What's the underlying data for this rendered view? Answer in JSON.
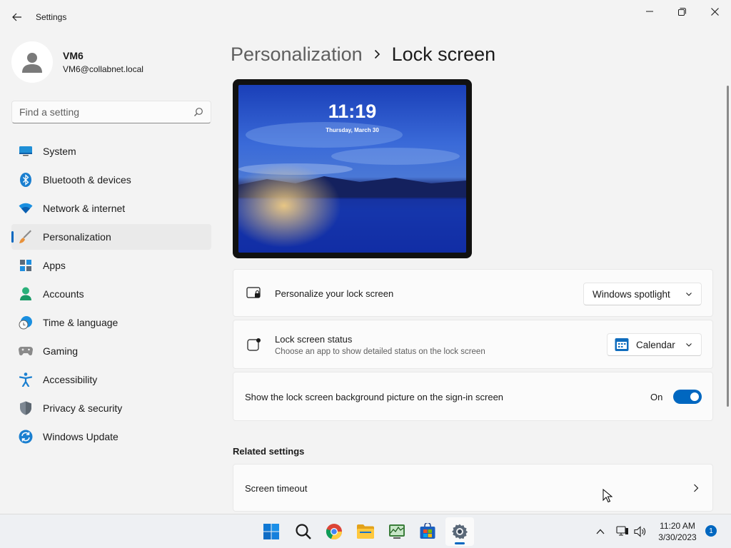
{
  "titlebar": {
    "app_title": "Settings"
  },
  "profile": {
    "name": "VM6",
    "email": "VM6@collabnet.local"
  },
  "search": {
    "placeholder": "Find a setting"
  },
  "sidebar": {
    "items": [
      {
        "label": "System",
        "icon": "monitor-icon"
      },
      {
        "label": "Bluetooth & devices",
        "icon": "bluetooth-icon"
      },
      {
        "label": "Network & internet",
        "icon": "wifi-icon"
      },
      {
        "label": "Personalization",
        "icon": "brush-icon",
        "selected": true
      },
      {
        "label": "Apps",
        "icon": "apps-icon"
      },
      {
        "label": "Accounts",
        "icon": "person-icon"
      },
      {
        "label": "Time & language",
        "icon": "clock-globe-icon"
      },
      {
        "label": "Gaming",
        "icon": "gamepad-icon"
      },
      {
        "label": "Accessibility",
        "icon": "accessibility-icon"
      },
      {
        "label": "Privacy & security",
        "icon": "shield-icon"
      },
      {
        "label": "Windows Update",
        "icon": "update-icon"
      }
    ]
  },
  "breadcrumb": {
    "parent": "Personalization",
    "current": "Lock screen"
  },
  "preview": {
    "time": "11:19",
    "date": "Thursday, March 30"
  },
  "settings": {
    "personalize": {
      "title": "Personalize your lock screen",
      "value": "Windows spotlight"
    },
    "status": {
      "title": "Lock screen status",
      "description": "Choose an app to show detailed status on the lock screen",
      "value": "Calendar"
    },
    "signin_bg": {
      "title": "Show the lock screen background picture on the sign-in screen",
      "state": "On"
    }
  },
  "related": {
    "title": "Related settings",
    "items": [
      {
        "label": "Screen timeout"
      }
    ]
  },
  "taskbar": {
    "clock_time": "11:20 AM",
    "clock_date": "3/30/2023",
    "notification_count": "1",
    "apps": [
      "start-icon",
      "search-icon",
      "chrome-icon",
      "file-explorer-icon",
      "task-manager-icon",
      "store-icon",
      "settings-icon"
    ]
  },
  "colors": {
    "accent": "#0067c0",
    "background": "#f3f3f3",
    "card": "#fbfbfb"
  }
}
